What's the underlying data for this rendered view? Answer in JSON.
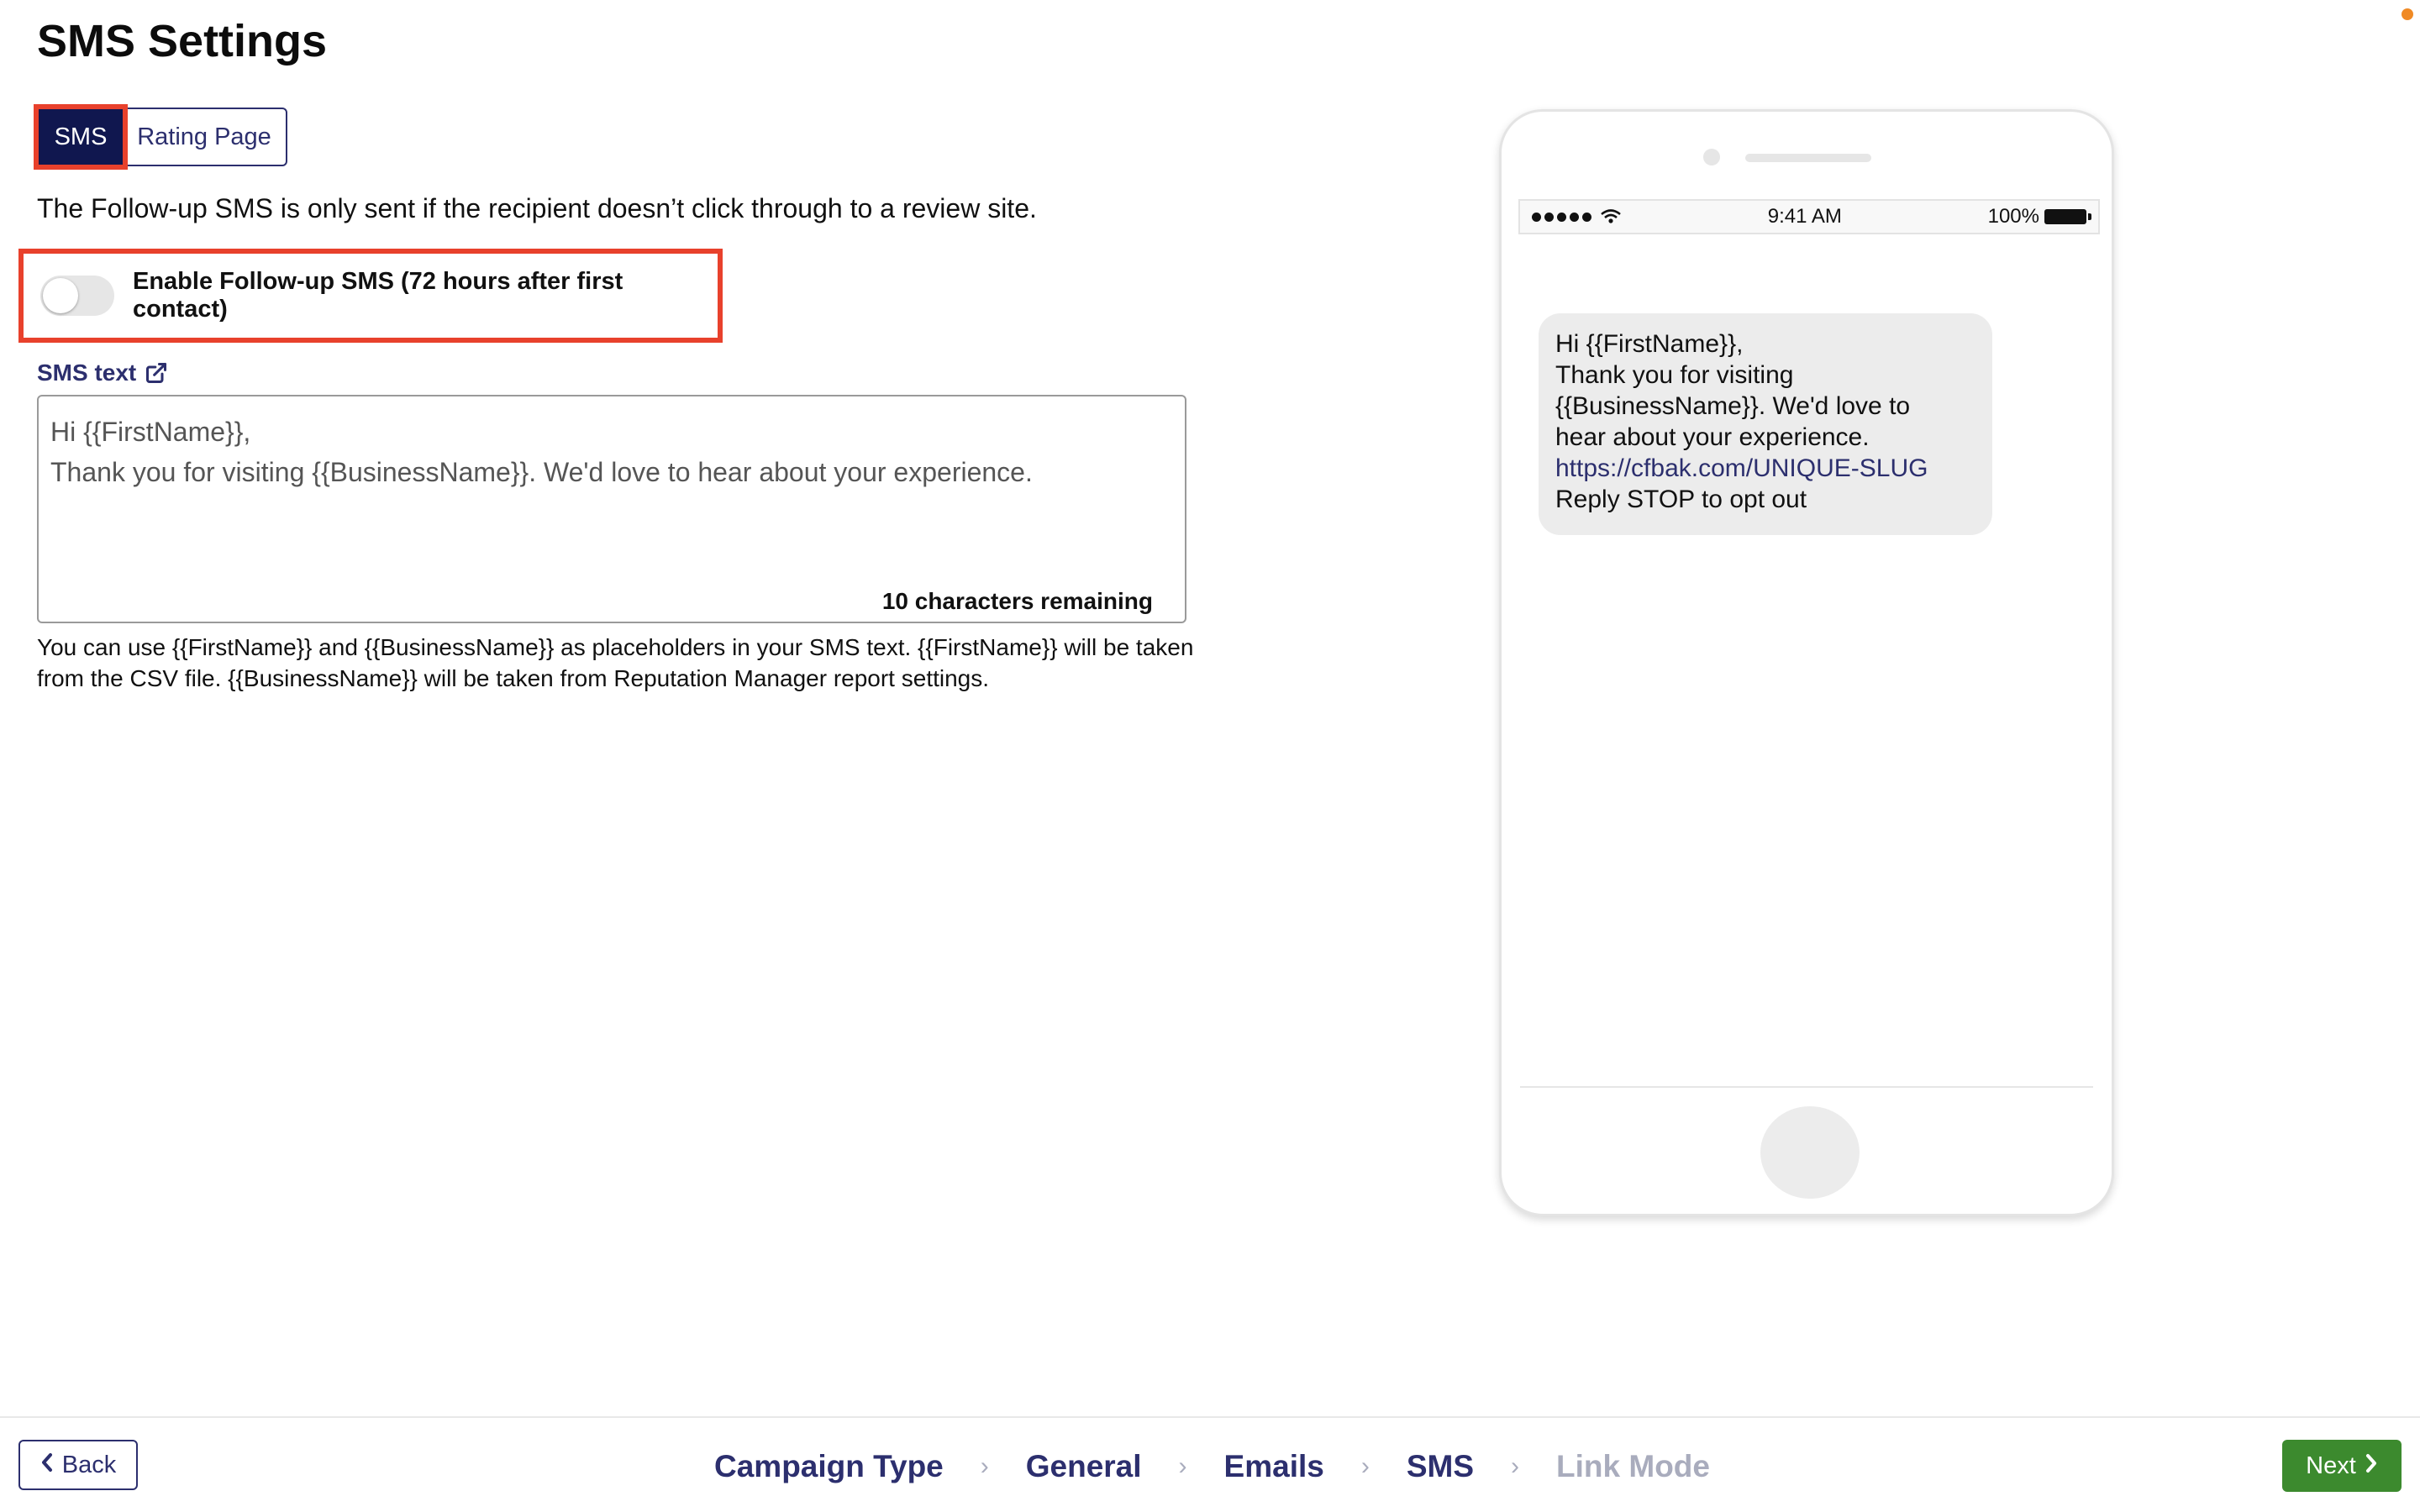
{
  "page": {
    "title": "SMS Settings"
  },
  "tabs": [
    {
      "label": "SMS",
      "active": true
    },
    {
      "label": "Rating Page",
      "active": false
    }
  ],
  "intro_text": "The Follow-up SMS is only sent if the recipient doesn’t click through to a review site.",
  "followup_toggle": {
    "label": "Enable Follow-up SMS (72 hours after first contact)",
    "enabled": false
  },
  "sms_text": {
    "label": "SMS text",
    "link_icon": "external-link-icon",
    "value": "Hi {{FirstName}},\nThank you for visiting {{BusinessName}}. We'd love to hear about your experience.",
    "chars_remaining": "10 characters remaining"
  },
  "help_text": "You can use {{FirstName}} and {{BusinessName}} as placeholders in your SMS text. {{FirstName}} will be taken from the CSV file. {{BusinessName}} will be taken from Reputation Manager report settings.",
  "phone_preview": {
    "status_bar": {
      "time": "9:41 AM",
      "battery": "100%"
    },
    "message": {
      "lines": [
        "Hi {{FirstName}},",
        "Thank you for visiting",
        "{{BusinessName}}. We'd love to",
        "hear about your experience."
      ],
      "link": "https://cfbak.com/UNIQUE-SLUG",
      "opt_out": "Reply STOP to opt out"
    }
  },
  "footer": {
    "back_label": "Back",
    "next_label": "Next",
    "steps": [
      {
        "label": "Campaign Type",
        "enabled": true
      },
      {
        "label": "General",
        "enabled": true
      },
      {
        "label": "Emails",
        "enabled": true
      },
      {
        "label": "SMS",
        "enabled": true
      },
      {
        "label": "Link Mode",
        "enabled": false
      }
    ]
  },
  "colors": {
    "primary_navy": "#10174f",
    "link_navy": "#2c2f6e",
    "highlight_red": "#e8412c",
    "next_green": "#3c8a2e",
    "accent_orange": "#f08a24"
  }
}
